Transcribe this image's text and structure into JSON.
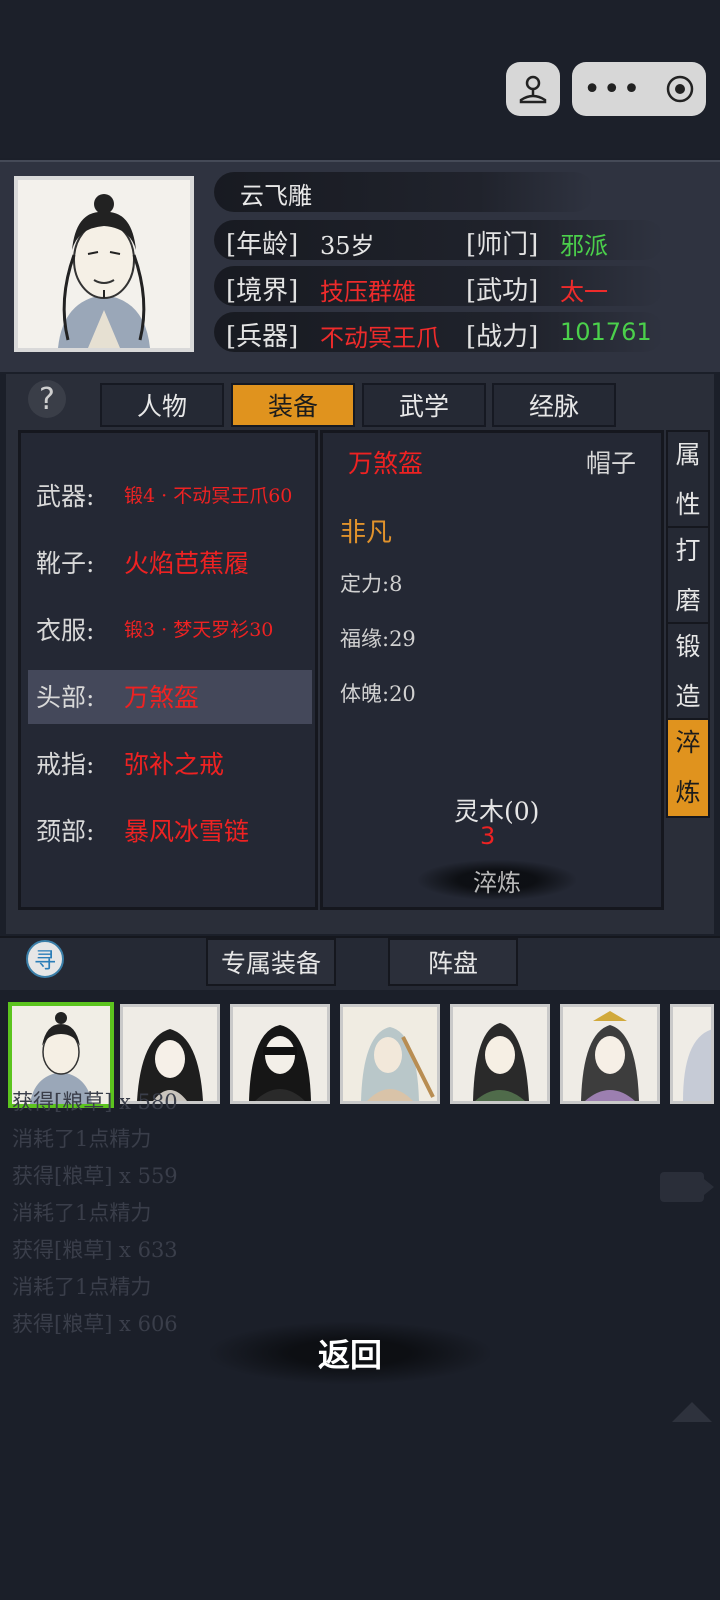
{
  "profile": {
    "name": "云飞雕",
    "age_label": "[年龄]",
    "age_value": "35岁",
    "sect_label": "[师门]",
    "sect_value": "邪派",
    "realm_label": "[境界]",
    "realm_value": "技压群雄",
    "martial_label": "[武功]",
    "martial_value": "太一",
    "weapon_label": "[兵器]",
    "weapon_value": "不动冥王爪",
    "power_label": "[战力]",
    "power_value": "101761"
  },
  "help_icon": "?",
  "tabs": [
    {
      "label": "人物",
      "active": false
    },
    {
      "label": "装备",
      "active": true
    },
    {
      "label": "武学",
      "active": false
    },
    {
      "label": "经脉",
      "active": false
    }
  ],
  "equipment": [
    {
      "slot": "武器:",
      "item": "锻4 · 不动冥王爪60"
    },
    {
      "slot": "靴子:",
      "item": "火焰芭蕉履"
    },
    {
      "slot": "衣服:",
      "item": "锻3 · 梦天罗衫30"
    },
    {
      "slot": "头部:",
      "item": "万煞盔"
    },
    {
      "slot": "戒指:",
      "item": "弥补之戒"
    },
    {
      "slot": "颈部:",
      "item": "暴风冰雪链"
    }
  ],
  "detail": {
    "item_name": "万煞盔",
    "slot_name": "帽子",
    "quality": "非凡",
    "stats": [
      "定力:8",
      "福缘:29",
      "体魄:20"
    ],
    "material": "灵木(0)",
    "material_cost": "3",
    "action_button": "淬炼"
  },
  "side_tabs": [
    {
      "chars": [
        "属",
        "性"
      ],
      "active": false
    },
    {
      "chars": [
        "打",
        "磨"
      ],
      "active": false
    },
    {
      "chars": [
        "锻",
        "造"
      ],
      "active": false
    },
    {
      "chars": [
        "淬",
        "炼"
      ],
      "active": true
    }
  ],
  "seek_icon": "寻",
  "lower_tabs": [
    "专属装备",
    "阵盘"
  ],
  "log_lines": [
    "获得[粮草] x 580",
    "消耗了1点精力",
    "获得[粮草] x 559",
    "消耗了1点精力",
    "获得[粮草] x 633",
    "消耗了1点精力",
    "获得[粮草] x 606"
  ],
  "back_button": "返回",
  "colors": {
    "accent": "#e0931e",
    "rare_red": "#ee2222",
    "sect_green": "#4bd04b",
    "quality_orange": "#e0922c"
  }
}
